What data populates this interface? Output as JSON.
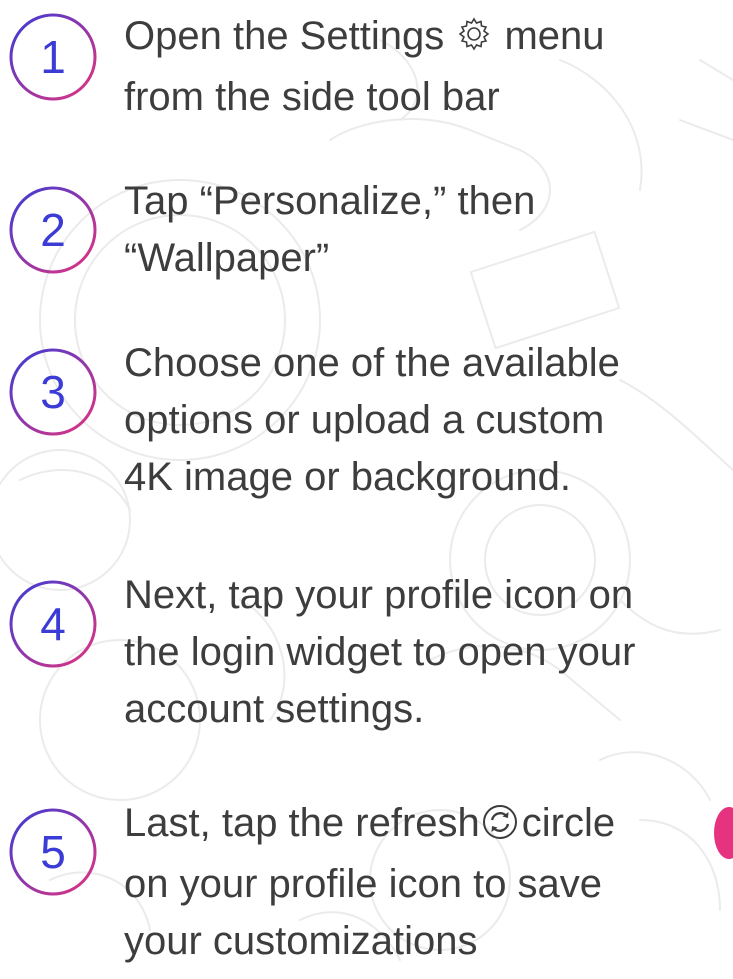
{
  "steps": [
    {
      "number": "1",
      "line1_before_icon": "Open the Settings",
      "line1_after_icon": "menu",
      "line2": "from the side tool bar",
      "icon": "gear-icon"
    },
    {
      "number": "2",
      "line1": "Tap “Personalize,” then",
      "line2": "“Wallpaper”"
    },
    {
      "number": "3",
      "line1": "Choose one of the available",
      "line2": "options or upload a custom",
      "line3": "4K image or background."
    },
    {
      "number": "4",
      "line1": "Next, tap your profile icon on",
      "line2": "the login widget to open your",
      "line3": "account settings."
    },
    {
      "number": "5",
      "line1_before_icon": "Last, tap the refresh",
      "line1_after_icon": "circle",
      "line2": "on your profile icon to save",
      "line3": "your customizations",
      "icon": "refresh-icon"
    }
  ],
  "colors": {
    "gradient_start": "#3b3bd6",
    "gradient_end": "#e5337f",
    "text": "#3d3d3d",
    "doodle": "#ebebeb"
  }
}
